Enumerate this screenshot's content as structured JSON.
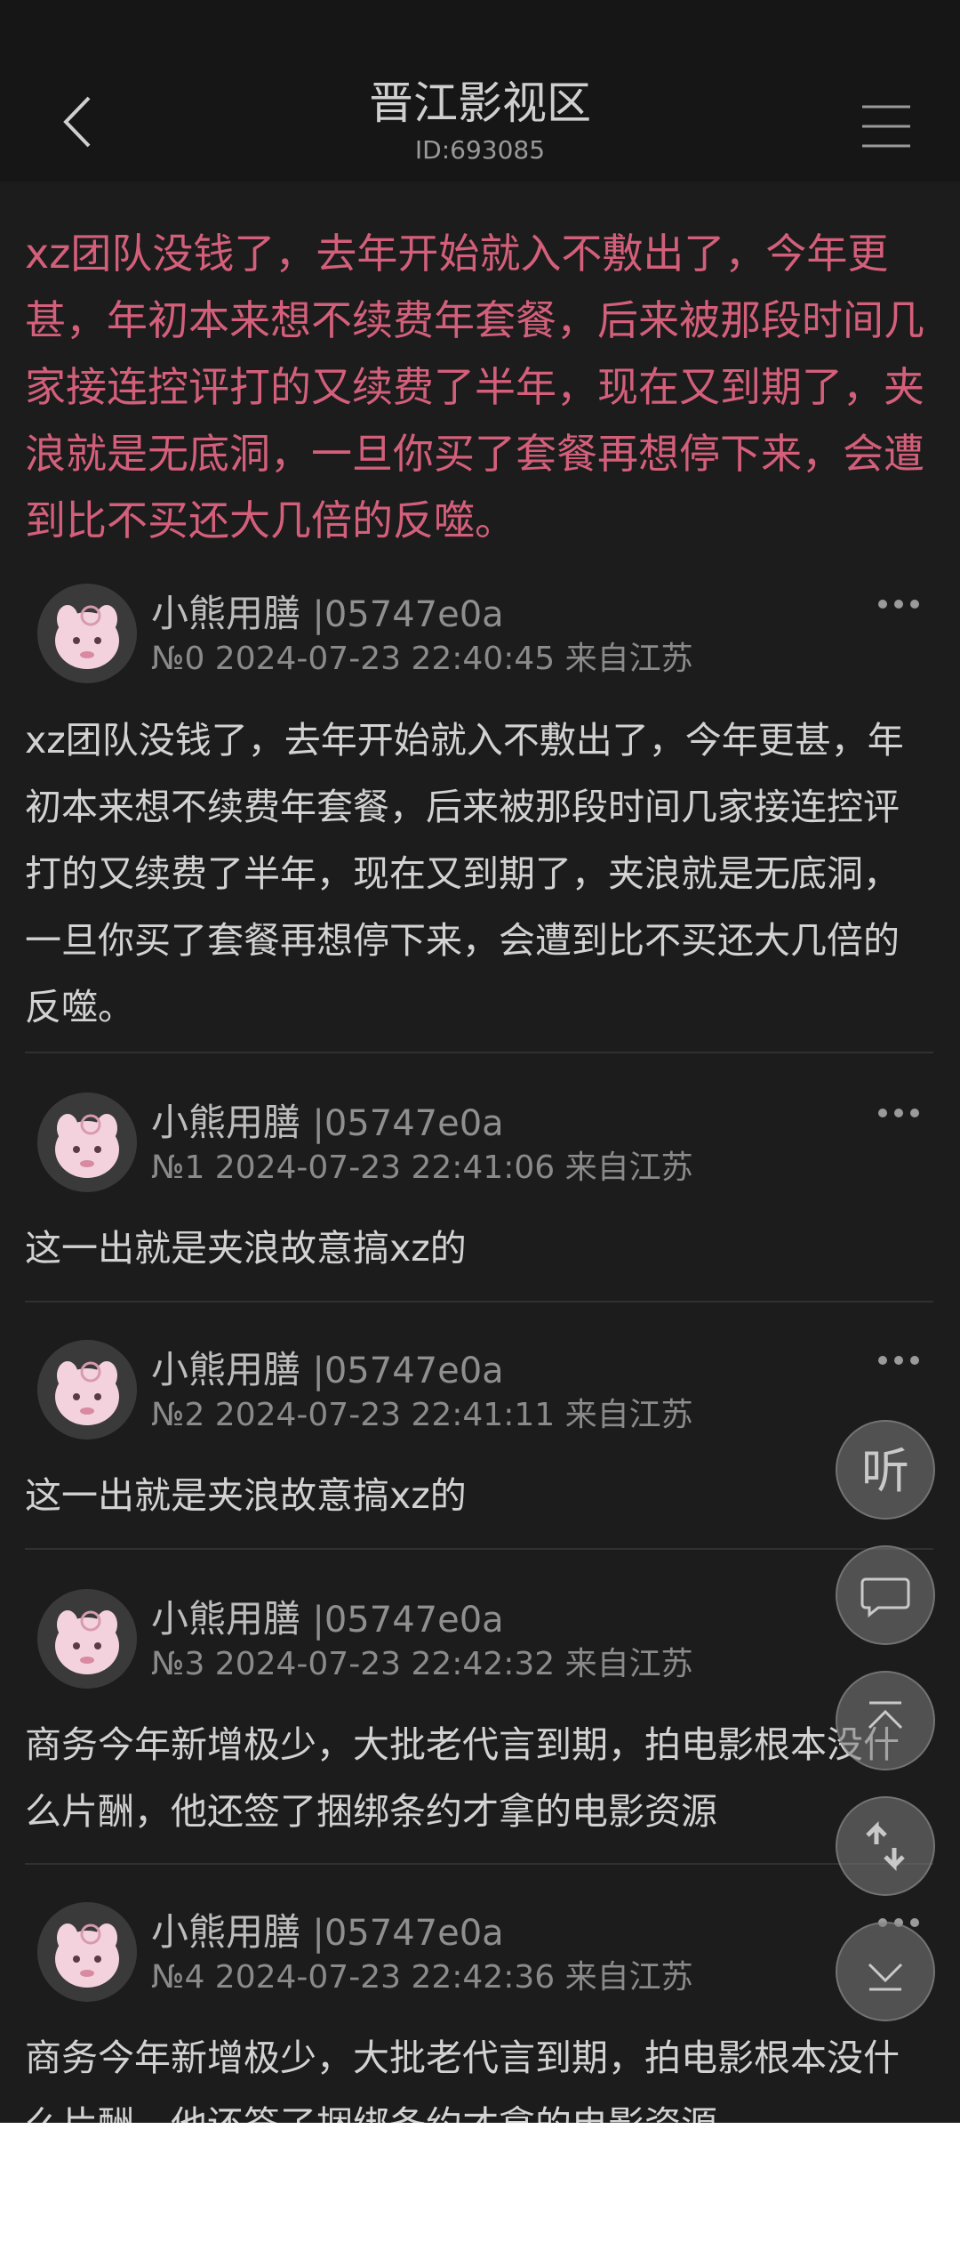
{
  "header": {
    "title": "晋江影视区",
    "subtitle": "ID:693085"
  },
  "topic_title": "xz团队没钱了，去年开始就入不敷出了，今年更甚，年初本来想不续费年套餐，后来被那段时间几家接连控评打的又续费了半年，现在又到期了，夹浪就是无底洞，一旦你买了套餐再想停下来，会遭到比不买还大几倍的反噬。",
  "posts": [
    {
      "username": "小熊用膳",
      "uid": "|05747e0a",
      "meta": "№0 2024-07-23 22:40:45 来自江苏",
      "content": "xz团队没钱了，去年开始就入不敷出了，今年更甚，年初本来想不续费年套餐，后来被那段时间几家接连控评打的又续费了半年，现在又到期了，夹浪就是无底洞，一旦你买了套餐再想停下来，会遭到比不买还大几倍的反噬。"
    },
    {
      "username": "小熊用膳",
      "uid": "|05747e0a",
      "meta": "№1 2024-07-23 22:41:06 来自江苏",
      "content": "这一出就是夹浪故意搞xz的"
    },
    {
      "username": "小熊用膳",
      "uid": "|05747e0a",
      "meta": "№2 2024-07-23 22:41:11 来自江苏",
      "content": "这一出就是夹浪故意搞xz的"
    },
    {
      "username": "小熊用膳",
      "uid": "|05747e0a",
      "meta": "№3 2024-07-23 22:42:32 来自江苏",
      "content": "商务今年新增极少，大批老代言到期，拍电影根本没什么片酬，他还签了捆绑条约才拿的电影资源"
    },
    {
      "username": "小熊用膳",
      "uid": "|05747e0a",
      "meta": "№4 2024-07-23 22:42:36 来自江苏",
      "content": "商务今年新增极少，大批老代言到期，拍电影根本没什么片酬，他还签了捆绑条约才拿的电影资源"
    }
  ],
  "floating_buttons": {
    "listen_label": "听"
  },
  "colors": {
    "background": "#1c1c1c",
    "header_bg": "#161616",
    "topic_text": "#d45f7a",
    "body_text": "#d2d2d2",
    "meta_text": "#8a8a8a"
  },
  "icons": [
    "back-arrow-icon",
    "menu-icon",
    "more-options-icon",
    "avatar-pink-creature",
    "listen-icon",
    "comment-icon",
    "scroll-top-icon",
    "refresh-swap-icon",
    "scroll-bottom-icon"
  ]
}
